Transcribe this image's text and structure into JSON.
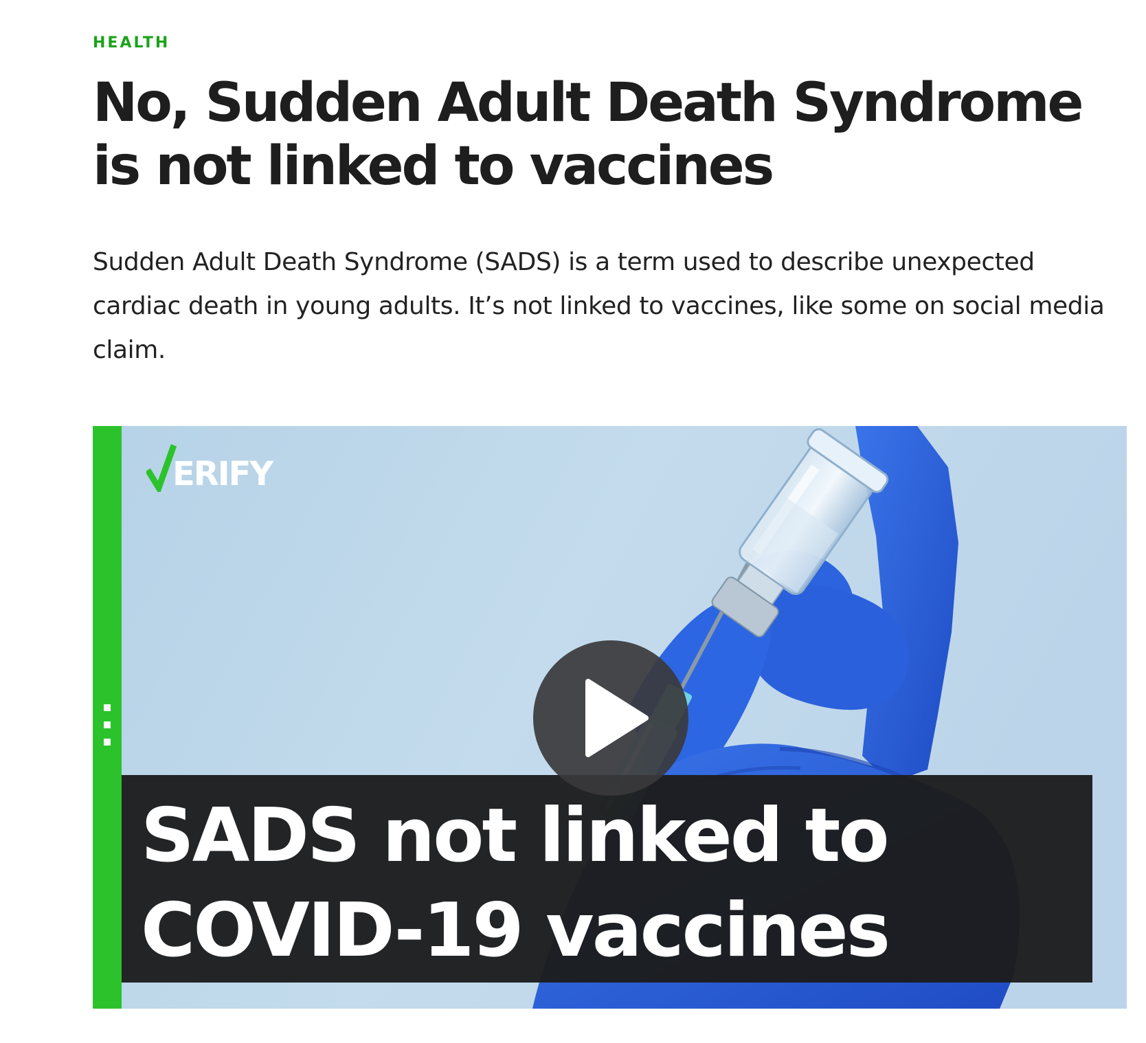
{
  "article": {
    "category": "HEALTH",
    "headline": "No, Sudden Adult Death Syndrome is not linked to vaccines",
    "dek": "Sudden Adult Death Syndrome (SADS) is a term used to describe unexpected cardiac death in young adults. It’s not linked to vaccines, like some on social media claim."
  },
  "video": {
    "logo_text": "VERIFY",
    "caption": "SADS not linked to COVID-19 vaccines",
    "play_icon": "play-icon",
    "accent_color": "#2cc22c",
    "glove_color": "#2b5fd9",
    "background_color": "#bcd6ea"
  }
}
